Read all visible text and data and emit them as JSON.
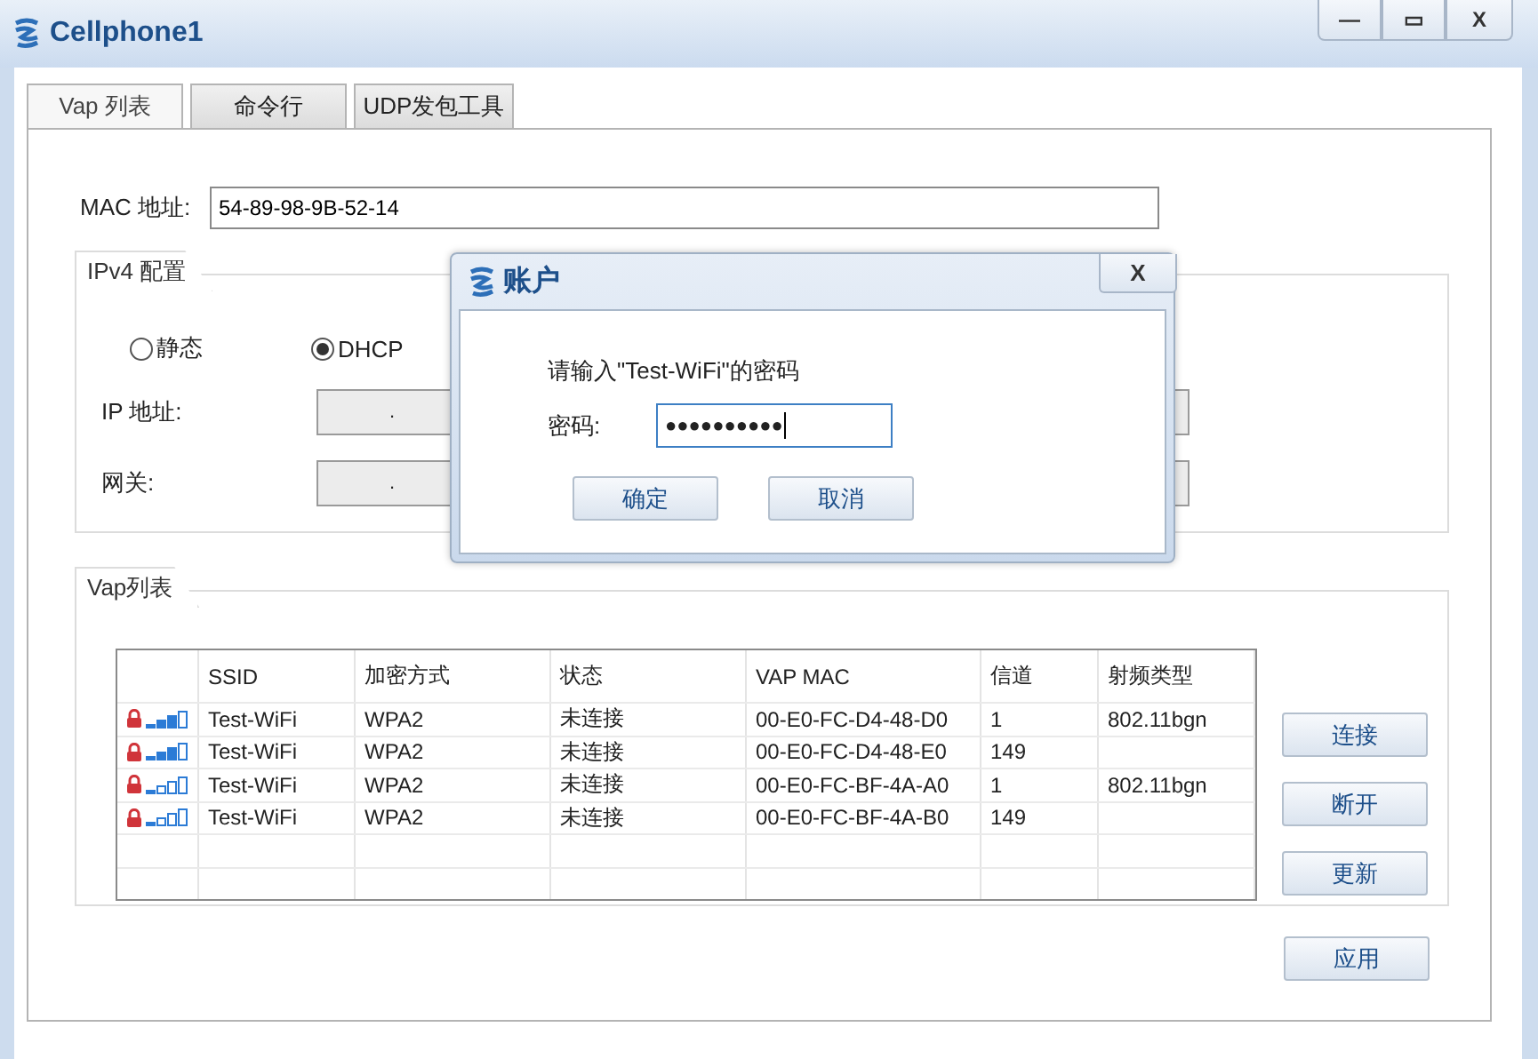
{
  "window": {
    "title": "Cellphone1",
    "controls": [
      "—",
      "▭",
      "X"
    ]
  },
  "tabs": [
    {
      "label": "Vap 列表",
      "selected": true
    },
    {
      "label": "命令行",
      "selected": false
    },
    {
      "label": "UDP发包工具",
      "selected": false
    }
  ],
  "mac": {
    "label": "MAC 地址:",
    "value": "54-89-98-9B-52-14"
  },
  "ipv4": {
    "title": "IPv4 配置",
    "modes": [
      {
        "label": "静态",
        "selected": false
      },
      {
        "label": "DHCP",
        "selected": true
      }
    ],
    "fields": [
      {
        "label": "IP 地址:",
        "value": "."
      },
      {
        "label": "网关:",
        "value": "."
      }
    ]
  },
  "vap": {
    "title": "Vap列表",
    "table": {
      "columns": [
        "",
        "SSID",
        "加密方式",
        "状态",
        "VAP MAC",
        "信道",
        "射频类型"
      ],
      "rows": [
        {
          "kind": "strong",
          "locked": true,
          "cells": [
            "",
            "Test-WiFi",
            "WPA2",
            "未连接",
            "00-E0-FC-D4-48-D0",
            "1",
            "802.11bgn"
          ]
        },
        {
          "kind": "strong",
          "locked": true,
          "cells": [
            "",
            "Test-WiFi",
            "WPA2",
            "未连接",
            "00-E0-FC-D4-48-E0",
            "149",
            ""
          ]
        },
        {
          "kind": "weak",
          "locked": true,
          "cells": [
            "",
            "Test-WiFi",
            "WPA2",
            "未连接",
            "00-E0-FC-BF-4A-A0",
            "1",
            "802.11bgn"
          ]
        },
        {
          "kind": "weak",
          "locked": true,
          "cells": [
            "",
            "Test-WiFi",
            "WPA2",
            "未连接",
            "00-E0-FC-BF-4A-B0",
            "149",
            ""
          ]
        }
      ]
    },
    "buttons": [
      "连接",
      "断开",
      "更新"
    ]
  },
  "apply_button": "应用",
  "dialog": {
    "title": "账户",
    "close": "X",
    "prompt": "请输入\"Test-WiFi\"的密码",
    "password_label": "密码:",
    "password_value": "●●●●●●●●●●",
    "buttons": [
      "确定",
      "取消"
    ]
  }
}
